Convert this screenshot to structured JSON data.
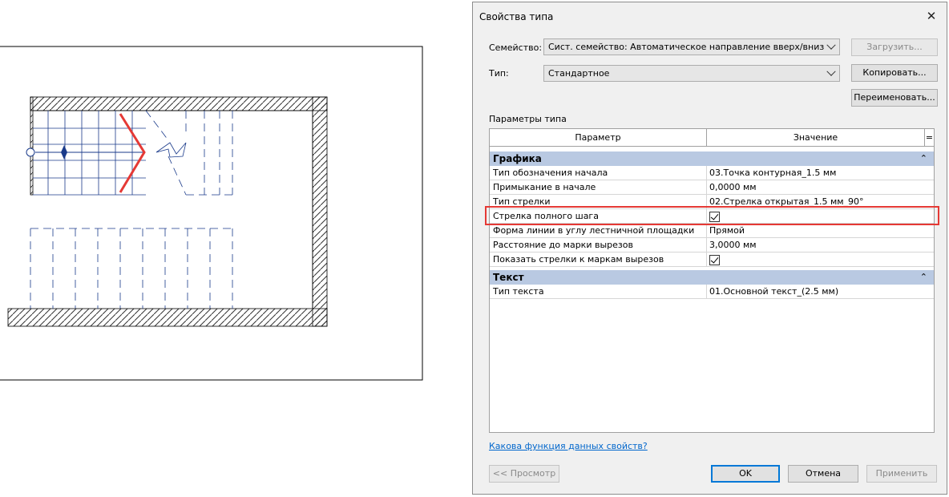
{
  "dialog": {
    "title": "Свойства типа",
    "family_label": "Семейство:",
    "family_value": "Сист. семейство: Автоматическое направление вверх/вниз",
    "type_label": "Тип:",
    "type_value": "Стандартное",
    "load_button": "Загрузить...",
    "copy_button": "Копировать...",
    "rename_button": "Переименовать...",
    "type_params_label": "Параметры типа",
    "grid": {
      "col_param": "Параметр",
      "col_value": "Значение",
      "col_extra": "=",
      "groups": [
        {
          "name": "Графика",
          "rows": [
            {
              "param": "Тип обозначения начала",
              "value": "03.Точка контурная_1.5 мм"
            },
            {
              "param": "Примыкание в начале",
              "value": "0,0000 мм"
            },
            {
              "param": "Тип стрелки",
              "value": "02.Стрелка открытая_1.5 мм_90°"
            },
            {
              "param": "Стрелка полного шага",
              "value": "",
              "checked": true
            },
            {
              "param": "Форма линии в углу лестничной площадки",
              "value": "Прямой"
            },
            {
              "param": "Расстояние до марки вырезов",
              "value": "3,0000 мм"
            },
            {
              "param": "Показать стрелки к маркам вырезов",
              "value": "",
              "checked": true
            }
          ]
        },
        {
          "name": "Текст",
          "rows": [
            {
              "param": "Тип текста",
              "value": "01.Основной текст_(2.5 мм)"
            }
          ]
        }
      ]
    },
    "help_link": "Какова функция данных свойств?",
    "preview_button": "<< Просмотр",
    "ok_button": "OK",
    "cancel_button": "Отмена",
    "apply_button": "Применить"
  },
  "icons": {
    "close": "close-icon",
    "dropdown": "chevron-down-icon",
    "collapse": "double-chevron-up-icon",
    "check": "checkmark-icon"
  },
  "colors": {
    "highlight": "#e53935",
    "group_header": "#b9c9e2",
    "link": "#0066cc",
    "drawing_blue": "#1a3a8a"
  }
}
